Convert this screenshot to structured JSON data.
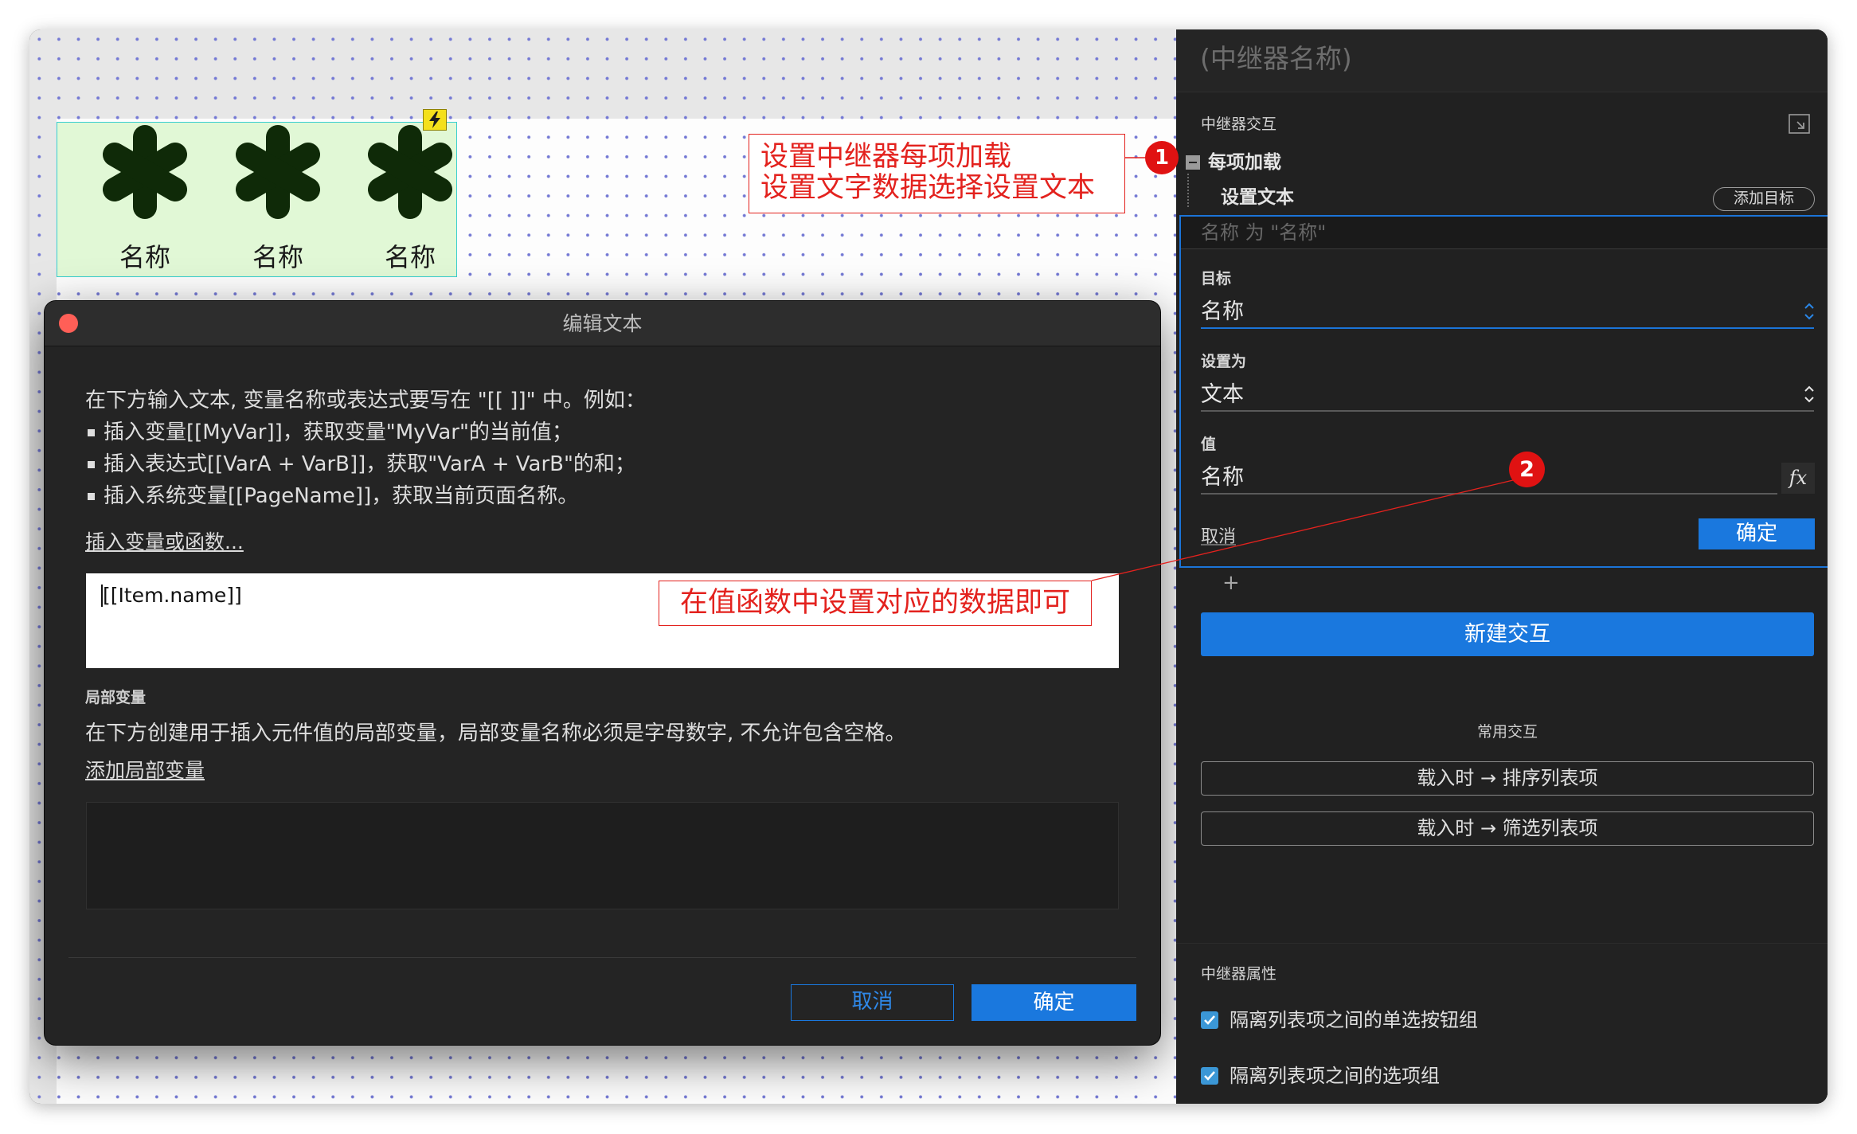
{
  "colors": {
    "accent": "#1a78de",
    "annotation_red": "#e3221e",
    "repeater_fill": "#e1f8d6",
    "repeater_border": "#38cfcf",
    "asterisk": "#0f2a08"
  },
  "canvas": {
    "repeater": {
      "badge_icon": "lightning-icon",
      "items": [
        {
          "icon": "asterisk-icon",
          "label": "名称"
        },
        {
          "icon": "asterisk-icon",
          "label": "名称"
        },
        {
          "icon": "asterisk-icon",
          "label": "名称"
        }
      ]
    }
  },
  "annotations": [
    {
      "badge": "1",
      "lines": [
        "设置中继器每项加载",
        "设置文字数据选择设置文本"
      ]
    },
    {
      "badge": "2",
      "text": "在值函数中设置对应的数据即可"
    }
  ],
  "dialog": {
    "title": "编辑文本",
    "close_icon": "close-dot-icon",
    "intro": "在下方输入文本, 变量名称或表达式要写在 \"[[ ]]\" 中。例如：",
    "examples": [
      "插入变量[[MyVar]]，获取变量\"MyVar\"的当前值；",
      "插入表达式[[VarA + VarB]]，获取\"VarA + VarB\"的和；",
      "插入系统变量[[PageName]]，获取当前页面名称。"
    ],
    "insert_link": "插入变量或函数...",
    "text_value": "[[Item.name]]",
    "local_vars": {
      "heading": "局部变量",
      "description": "在下方创建用于插入元件值的局部变量，局部变量名称必须是字母数字, 不允许包含空格。",
      "add_link": "添加局部变量"
    },
    "cancel_label": "取消",
    "ok_label": "确定"
  },
  "panel": {
    "title": "(中继器名称)",
    "interactions_heading": "中继器交互",
    "event": "每项加载",
    "action": "设置文本",
    "add_target_label": "添加目标",
    "editor": {
      "summary": "名称 为 \"名称\"",
      "target_label": "目标",
      "target_value": "名称",
      "set_to_label": "设置为",
      "set_to_value": "文本",
      "value_label": "值",
      "value_value": "名称",
      "fx_label": "fx",
      "cancel_label": "取消",
      "ok_label": "确定"
    },
    "add_case_label": "+",
    "new_interaction_label": "新建交互",
    "common_heading": "常用交互",
    "common_actions": [
      "载入时 → 排序列表项",
      "载入时 → 筛选列表项"
    ],
    "properties_heading": "中继器属性",
    "properties": [
      {
        "label": "隔离列表项之间的单选按钮组",
        "checked": true
      },
      {
        "label": "隔离列表项之间的选项组",
        "checked": true
      }
    ]
  }
}
